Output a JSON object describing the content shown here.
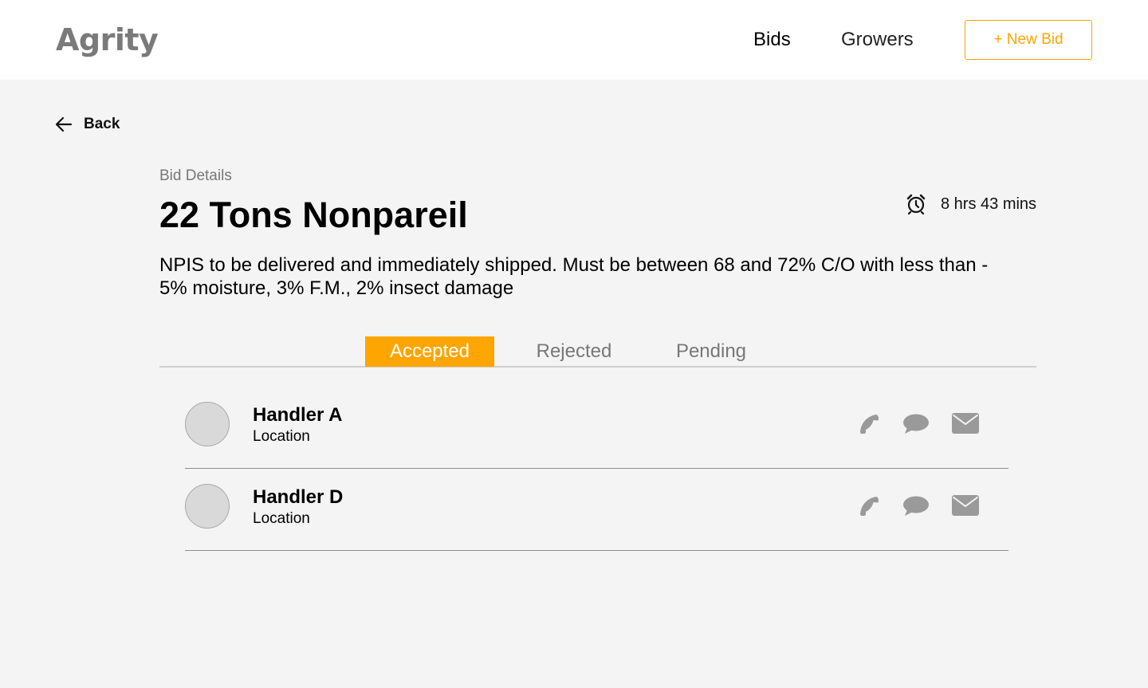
{
  "header": {
    "logo": "Agrity",
    "nav": [
      {
        "label": "Bids"
      },
      {
        "label": "Growers"
      }
    ],
    "new_bid_label": "+ New Bid"
  },
  "back": {
    "label": "Back",
    "icon": "arrow-left-icon"
  },
  "bid": {
    "section_label": "Bid Details",
    "title": "22 Tons Nonpareil",
    "time_remaining": "8 hrs 43 mins",
    "time_icon": "alarm-clock-icon",
    "description_line1": "NPIS to be delivered and immediately shipped. Must be between 68 and 72% C/O with less than -",
    "description_line2": "5% moisture, 3% F.M., 2% insect damage"
  },
  "tabs": [
    {
      "label": "Accepted",
      "active": true
    },
    {
      "label": "Rejected",
      "active": false
    },
    {
      "label": "Pending",
      "active": false
    }
  ],
  "handlers": [
    {
      "name": "Handler A",
      "location": "Location"
    },
    {
      "name": "Handler D",
      "location": "Location"
    }
  ],
  "actions": {
    "icons": [
      "phone-icon",
      "chat-icon",
      "mail-icon"
    ]
  },
  "colors": {
    "accent": "#ffa500",
    "page_bg": "#f4f4f4",
    "icon_gray": "#9a9a9a",
    "logo_gray": "#7a7a7a"
  }
}
